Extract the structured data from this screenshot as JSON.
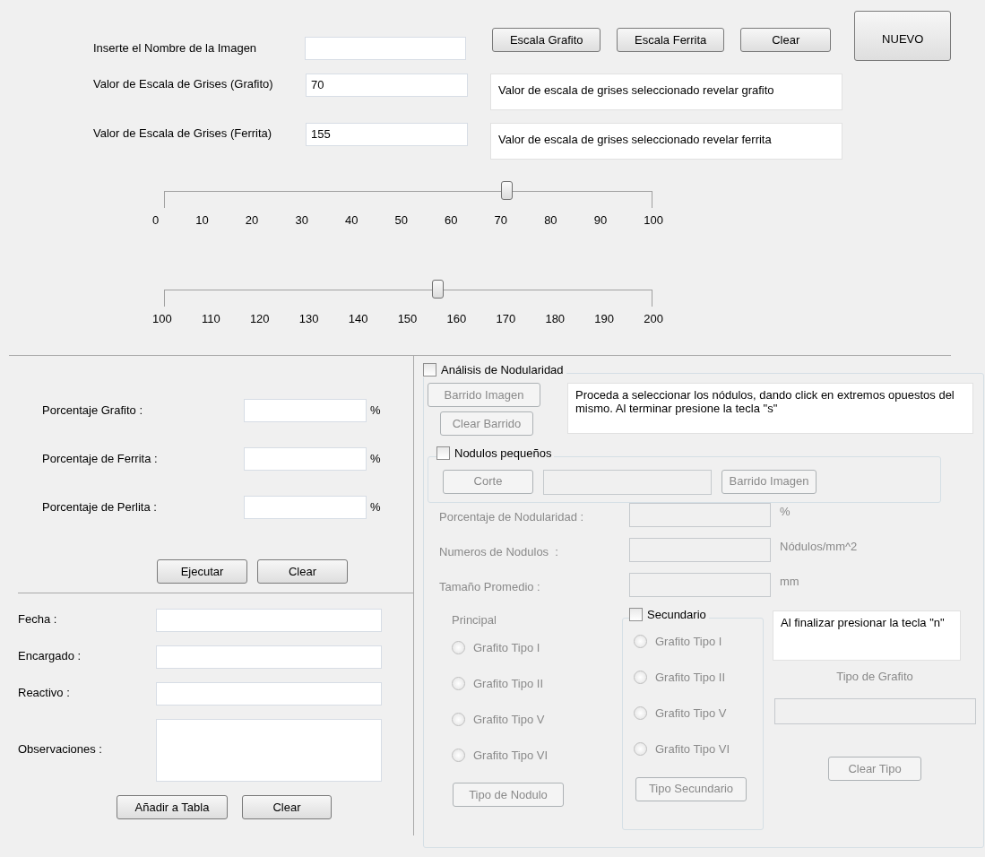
{
  "image_name": {
    "label": "Inserte el Nombre de la Imagen"
  },
  "top_buttons": [
    "Escala Grafito",
    "Escala Ferrita",
    "Clear"
  ],
  "new_button": "NUEVO",
  "gray_values": [
    {
      "label": "Valor de Escala de Grises (Grafito)",
      "value": "70",
      "message": "Valor de escala de grises seleccionado revelar grafito"
    },
    {
      "label": "Valor de Escala de Grises (Ferrita)",
      "value": "155",
      "message": "Valor de escala de grises seleccionado revelar ferrita"
    }
  ],
  "sliders": [
    {
      "level": 0.7,
      "ticks": [
        "0",
        "10",
        "20",
        "30",
        "40",
        "50",
        "60",
        "70",
        "80",
        "90",
        "100"
      ]
    },
    {
      "level": 0.56,
      "ticks": [
        "100",
        "110",
        "120",
        "130",
        "140",
        "150",
        "160",
        "170",
        "180",
        "190",
        "200"
      ]
    }
  ],
  "percentages": {
    "rows": [
      {
        "label": "Porcentaje Grafito :",
        "unit": "%"
      },
      {
        "label": "Porcentaje de Ferrita :",
        "unit": "%"
      },
      {
        "label": "Porcentaje de Perlita :",
        "unit": "%"
      }
    ],
    "buttons": [
      "Ejecutar",
      "Clear"
    ]
  },
  "record": {
    "fields": [
      {
        "label": "Fecha :",
        "kind": "input"
      },
      {
        "label": "Encargado :",
        "kind": "input"
      },
      {
        "label": "Reactivo :",
        "kind": "input"
      },
      {
        "label": "Observaciones :",
        "kind": "textarea"
      }
    ],
    "buttons": [
      "Añadir a Tabla",
      "Clear"
    ]
  },
  "nodularity": {
    "label": "Análisis de Nodularidad",
    "checked": false,
    "scan_buttons": [
      "Barrido Imagen",
      "Clear Barrido"
    ],
    "instruction": "Proceda a seleccionar los nódulos, dando click en extremos opuestos del mismo. Al terminar presione la tecla \"s\"",
    "small_nodules": {
      "label": "Nodulos pequeños",
      "checked": false,
      "cut_button": "Corte",
      "scan_button": "Barrido Imagen"
    },
    "results": [
      {
        "label": "Porcentaje de Nodularidad :",
        "unit": "%"
      },
      {
        "label": "Numeros de Nodulos  :",
        "unit": "Nódulos/mm^2"
      },
      {
        "label": "Tamaño Promedio :",
        "unit": "mm"
      }
    ],
    "principal": {
      "title": "Principal",
      "options": [
        {
          "label": "Grafito Tipo I",
          "selected": false
        },
        {
          "label": "Grafito Tipo II",
          "selected": false
        },
        {
          "label": "Grafito Tipo V",
          "selected": false
        },
        {
          "label": "Grafito Tipo VI",
          "selected": false
        }
      ],
      "button": "Tipo de Nodulo"
    },
    "secondary": {
      "label": "Secundario",
      "checked": false,
      "options": [
        {
          "label": "Grafito Tipo I",
          "selected": false
        },
        {
          "label": "Grafito Tipo II",
          "selected": false
        },
        {
          "label": "Grafito Tipo V",
          "selected": false
        },
        {
          "label": "Grafito Tipo VI",
          "selected": false
        }
      ],
      "button": "Tipo Secundario"
    },
    "graphite_type": {
      "instruction": "Al finalizar presionar la tecla \"n\"",
      "title": "Tipo de Grafito",
      "button": "Clear Tipo"
    }
  }
}
